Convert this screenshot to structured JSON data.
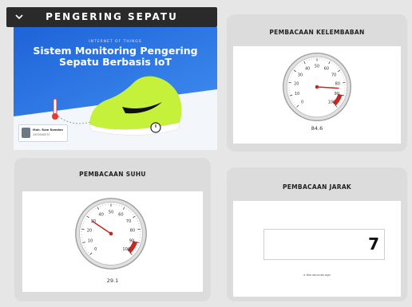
{
  "header": {
    "title": "PENGERING SEPATU",
    "collapse_icon": "chevron-down-icon"
  },
  "banner": {
    "kicker": "INTERNET OF THINGS",
    "headline_line1": "Sistem Monitoring Pengering",
    "headline_line2": "Sepatu Berbasis IoT",
    "author_name": "Muh. Ram Ramdan",
    "author_id": "1903040070"
  },
  "humidity": {
    "title": "PEMBACAAN KELEMBABAN",
    "value": 84.6,
    "value_text": "84.6",
    "gauge": {
      "min": 0,
      "max": 100,
      "ticks": [
        "0",
        "10",
        "20",
        "30",
        "40",
        "50",
        "60",
        "70",
        "80",
        "90",
        "100"
      ],
      "danger_from": 90,
      "danger_color": "#c62828"
    }
  },
  "temperature": {
    "title": "PEMBACAAN SUHU",
    "value": 29.1,
    "value_text": "29.1",
    "gauge": {
      "min": 0,
      "max": 100,
      "ticks": [
        "0",
        "10",
        "20",
        "30",
        "40",
        "50",
        "60",
        "70",
        "80",
        "90",
        "100"
      ],
      "danger_from": 90,
      "danger_color": "#c62828"
    }
  },
  "distance": {
    "title": "PEMBACAAN JARAK",
    "value_text": "7",
    "updated_text": "a few seconds ago"
  },
  "colors": {
    "header_bg": "#2a2a2a",
    "card_bg": "#dcdcdc",
    "page_bg": "#e6e6e6",
    "banner_blue": "#2f6fe0",
    "needle": "#c62828"
  }
}
